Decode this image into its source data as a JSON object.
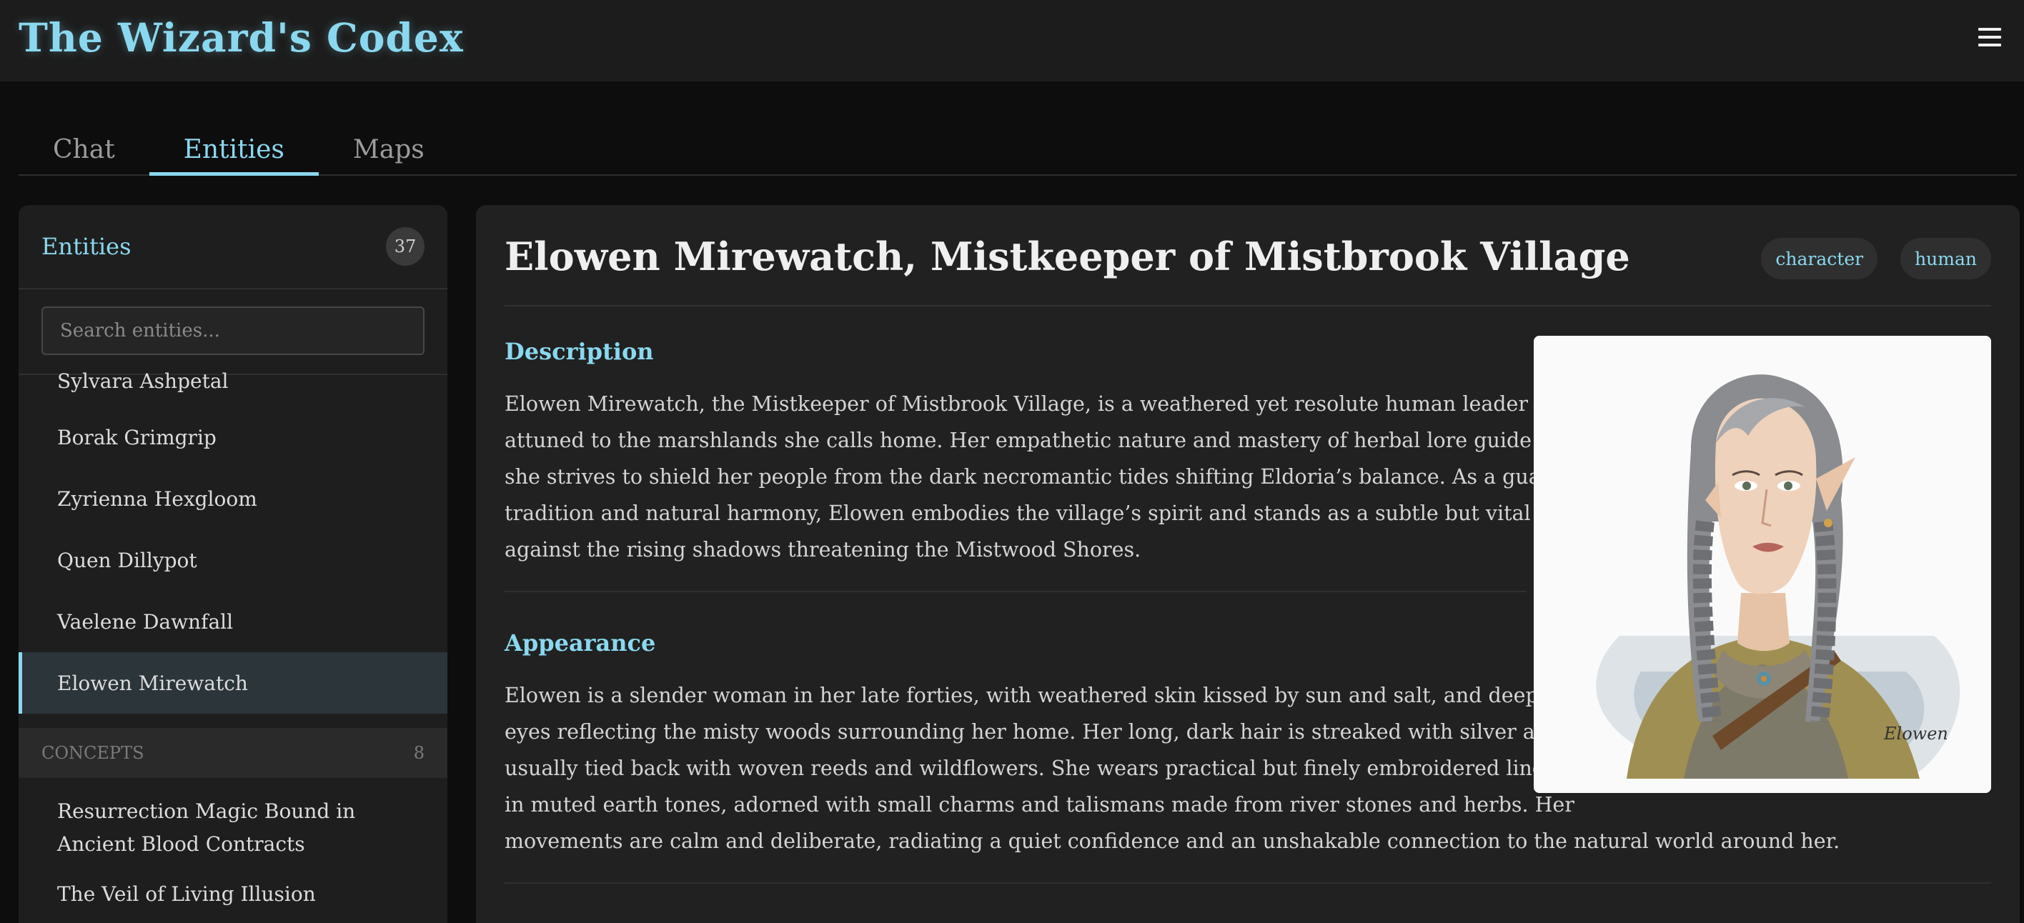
{
  "app": {
    "title": "The Wizard's Codex"
  },
  "tabs": [
    {
      "label": "Chat",
      "active": false
    },
    {
      "label": "Entities",
      "active": true
    },
    {
      "label": "Maps",
      "active": false
    }
  ],
  "sidebar": {
    "title": "Entities",
    "count": "37",
    "search_placeholder": "Search entities...",
    "items": [
      "Sylvara Ashpetal",
      "Borak Grimgrip",
      "Zyrienna Hexgloom",
      "Quen Dillypot",
      "Vaelene Dawnfall",
      "Elowen Mirewatch"
    ],
    "selected_item": "Elowen Mirewatch",
    "concepts_group": {
      "label": "CONCEPTS",
      "count": "8",
      "items": [
        "Resurrection Magic Bound in Ancient Blood Contracts",
        "The Veil of Living Illusion"
      ]
    }
  },
  "entity": {
    "title": "Elowen Mirewatch, Mistkeeper of Mistbrook Village",
    "tags": [
      "character",
      "human"
    ],
    "portrait_signature": "Elowen",
    "sections": [
      {
        "heading": "Description",
        "lines": [
          "Elowen Mirewatch, the Mistkeeper of Mistbrook Village, is a weathered yet resolute human leader deeply",
          "attuned to the marshlands she calls home. Her empathetic nature and mastery of herbal lore guide her as",
          "she strives to shield her people from the dark necromantic tides shifting Eldoria’s balance. As a guardian of",
          "tradition and natural harmony, Elowen embodies the village’s spirit and stands as a subtle but vital force",
          "against the rising shadows threatening the Mistwood Shores."
        ]
      },
      {
        "heading": "Appearance",
        "lines": [
          "Elowen is a slender woman in her late forties, with weathered skin kissed by sun and salt, and deep green",
          "eyes reflecting the misty woods surrounding her home. Her long, dark hair is streaked with silver and",
          "usually tied back with woven reeds and wildflowers. She wears practical but finely embroidered linen robes",
          "in muted earth tones, adorned with small charms and talismans made from river stones and herbs. Her",
          "movements are calm and deliberate, radiating a quiet confidence and an unshakable connection to the natural world around her."
        ]
      }
    ]
  },
  "colors": {
    "accent": "#8ad8ef",
    "background": "#0d0d0d",
    "panel": "#212121",
    "sidebar": "#1e1e1e",
    "selected_row": "#2b353a"
  },
  "icons": {
    "menu": "hamburger-menu-icon"
  }
}
